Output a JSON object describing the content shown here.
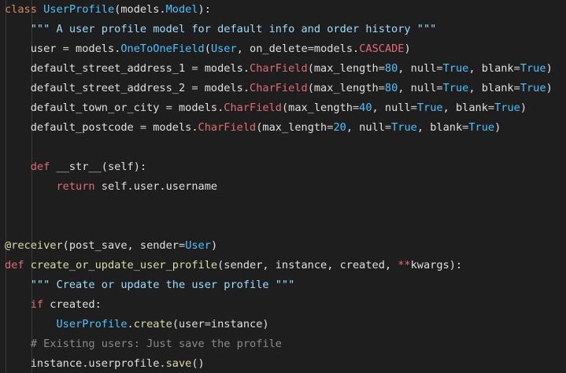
{
  "theme": {
    "background": "#1e1e1e",
    "keyword": "#569cd6",
    "control": "#c586c0",
    "class_name": "#4ec9b0",
    "function_name": "#dcdcaa",
    "string": "#ce9178",
    "number": "#b5cea8",
    "variable": "#9cdcfe",
    "comment": "#6a9955"
  },
  "code": {
    "lines": [
      [
        {
          "t": "class",
          "c": "kw"
        },
        {
          "t": " ",
          "c": "plain"
        },
        {
          "t": "UserProfile",
          "c": "cls"
        },
        {
          "t": "(models.",
          "c": "plain"
        },
        {
          "t": "Model",
          "c": "cls"
        },
        {
          "t": "):",
          "c": "plain"
        }
      ],
      [
        {
          "t": "    ",
          "c": "plain"
        },
        {
          "t": "\"\"\" A user profile model for default info and order history \"\"\"",
          "c": "str"
        }
      ],
      [
        {
          "t": "    user ",
          "c": "plain"
        },
        {
          "t": "=",
          "c": "op"
        },
        {
          "t": " models.",
          "c": "plain"
        },
        {
          "t": "OneToOneField",
          "c": "cls"
        },
        {
          "t": "(",
          "c": "plain"
        },
        {
          "t": "User",
          "c": "cls"
        },
        {
          "t": ", on_delete",
          "c": "plain"
        },
        {
          "t": "=",
          "c": "op"
        },
        {
          "t": "models.",
          "c": "plain"
        },
        {
          "t": "CASCADE",
          "c": "kwd"
        },
        {
          "t": ")",
          "c": "plain"
        }
      ],
      [
        {
          "t": "    default_street_address_1 ",
          "c": "plain"
        },
        {
          "t": "=",
          "c": "op"
        },
        {
          "t": " models.",
          "c": "plain"
        },
        {
          "t": "CharField",
          "c": "kwd"
        },
        {
          "t": "(max_length",
          "c": "plain"
        },
        {
          "t": "=",
          "c": "op"
        },
        {
          "t": "80",
          "c": "num"
        },
        {
          "t": ", null",
          "c": "plain"
        },
        {
          "t": "=",
          "c": "op"
        },
        {
          "t": "True",
          "c": "bool"
        },
        {
          "t": ", blank",
          "c": "plain"
        },
        {
          "t": "=",
          "c": "op"
        },
        {
          "t": "True",
          "c": "bool"
        },
        {
          "t": ")",
          "c": "plain"
        }
      ],
      [
        {
          "t": "    default_street_address_2 ",
          "c": "plain"
        },
        {
          "t": "=",
          "c": "op"
        },
        {
          "t": " models.",
          "c": "plain"
        },
        {
          "t": "CharField",
          "c": "kwd"
        },
        {
          "t": "(max_length",
          "c": "plain"
        },
        {
          "t": "=",
          "c": "op"
        },
        {
          "t": "80",
          "c": "num"
        },
        {
          "t": ", null",
          "c": "plain"
        },
        {
          "t": "=",
          "c": "op"
        },
        {
          "t": "True",
          "c": "bool"
        },
        {
          "t": ", blank",
          "c": "plain"
        },
        {
          "t": "=",
          "c": "op"
        },
        {
          "t": "True",
          "c": "bool"
        },
        {
          "t": ")",
          "c": "plain"
        }
      ],
      [
        {
          "t": "    default_town_or_city ",
          "c": "plain"
        },
        {
          "t": "=",
          "c": "op"
        },
        {
          "t": " models.",
          "c": "plain"
        },
        {
          "t": "CharField",
          "c": "kwd"
        },
        {
          "t": "(max_length",
          "c": "plain"
        },
        {
          "t": "=",
          "c": "op"
        },
        {
          "t": "40",
          "c": "num"
        },
        {
          "t": ", null",
          "c": "plain"
        },
        {
          "t": "=",
          "c": "op"
        },
        {
          "t": "True",
          "c": "bool"
        },
        {
          "t": ", blank",
          "c": "plain"
        },
        {
          "t": "=",
          "c": "op"
        },
        {
          "t": "True",
          "c": "bool"
        },
        {
          "t": ")",
          "c": "plain"
        }
      ],
      [
        {
          "t": "    default_postcode ",
          "c": "plain"
        },
        {
          "t": "=",
          "c": "op"
        },
        {
          "t": " models.",
          "c": "plain"
        },
        {
          "t": "CharField",
          "c": "kwd"
        },
        {
          "t": "(max_length",
          "c": "plain"
        },
        {
          "t": "=",
          "c": "op"
        },
        {
          "t": "20",
          "c": "num"
        },
        {
          "t": ", null",
          "c": "plain"
        },
        {
          "t": "=",
          "c": "op"
        },
        {
          "t": "True",
          "c": "bool"
        },
        {
          "t": ", blank",
          "c": "plain"
        },
        {
          "t": "=",
          "c": "op"
        },
        {
          "t": "True",
          "c": "bool"
        },
        {
          "t": ")",
          "c": "plain"
        }
      ],
      [],
      [
        {
          "t": "    ",
          "c": "plain"
        },
        {
          "t": "def",
          "c": "kwd"
        },
        {
          "t": " __str__(self):",
          "c": "plain"
        }
      ],
      [
        {
          "t": "        ",
          "c": "plain"
        },
        {
          "t": "return",
          "c": "kwd"
        },
        {
          "t": " self.user.username",
          "c": "plain"
        }
      ],
      [],
      [],
      [
        {
          "t": "@receiver",
          "c": "fn"
        },
        {
          "t": "(post_save, sender",
          "c": "plain"
        },
        {
          "t": "=",
          "c": "op"
        },
        {
          "t": "User",
          "c": "cls"
        },
        {
          "t": ")",
          "c": "plain"
        }
      ],
      [
        {
          "t": "def",
          "c": "kwd"
        },
        {
          "t": " ",
          "c": "plain"
        },
        {
          "t": "create_or_update_user_profile",
          "c": "fn"
        },
        {
          "t": "(sender, instance, created, ",
          "c": "plain"
        },
        {
          "t": "**",
          "c": "kwd"
        },
        {
          "t": "kwargs):",
          "c": "plain"
        }
      ],
      [
        {
          "t": "    ",
          "c": "plain"
        },
        {
          "t": "\"\"\" Create or update the user profile \"\"\"",
          "c": "str"
        }
      ],
      [
        {
          "t": "    ",
          "c": "plain"
        },
        {
          "t": "if",
          "c": "kwd"
        },
        {
          "t": " created:",
          "c": "plain"
        }
      ],
      [
        {
          "t": "        ",
          "c": "plain"
        },
        {
          "t": "UserProfile",
          "c": "cls"
        },
        {
          "t": ".",
          "c": "plain"
        },
        {
          "t": "create",
          "c": "fn"
        },
        {
          "t": "(user",
          "c": "plain"
        },
        {
          "t": "=",
          "c": "op"
        },
        {
          "t": "instance)",
          "c": "plain"
        }
      ],
      [
        {
          "t": "    ",
          "c": "plain"
        },
        {
          "t": "# Existing users: Just save the profile",
          "c": "cmt"
        }
      ],
      [
        {
          "t": "    instance.userprofile.",
          "c": "plain"
        },
        {
          "t": "save",
          "c": "fn"
        },
        {
          "t": "()",
          "c": "plain"
        }
      ]
    ]
  }
}
